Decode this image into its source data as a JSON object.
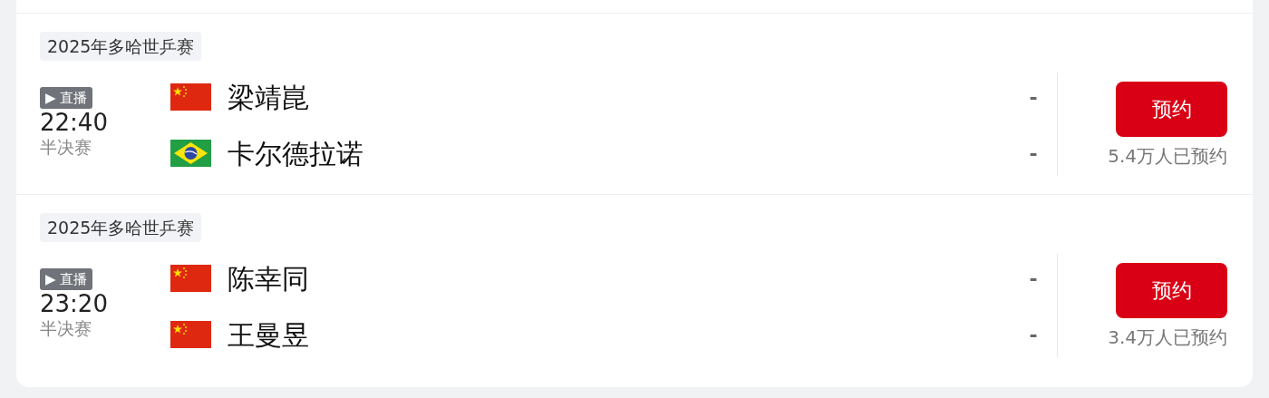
{
  "matches": [
    {
      "event": "2025年多哈世乒赛",
      "live_badge": "▶ 直播",
      "time": "22:40",
      "stage": "半决赛",
      "teams": [
        {
          "kind": "cn",
          "name": "梁靖崑",
          "score": "-"
        },
        {
          "kind": "br",
          "name": "卡尔德拉诺",
          "score": "-"
        }
      ],
      "button": "预约",
      "bookings": "5.4万人已预约"
    },
    {
      "event": "2025年多哈世乒赛",
      "live_badge": "▶ 直播",
      "time": "23:20",
      "stage": "半决赛",
      "teams": [
        {
          "kind": "cn",
          "name": "陈幸同",
          "score": "-"
        },
        {
          "kind": "cn",
          "name": "王曼昱",
          "score": "-"
        }
      ],
      "button": "预约",
      "bookings": "3.4万人已预约"
    }
  ]
}
